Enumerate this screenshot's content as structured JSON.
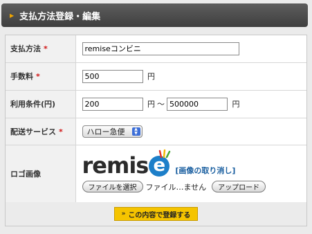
{
  "header": {
    "title": "支払方法登録・編集"
  },
  "form": {
    "method": {
      "label": "支払方法",
      "required_mark": "*",
      "value": "remiseコンビニ"
    },
    "fee": {
      "label": "手数料",
      "required_mark": "*",
      "value": "500",
      "unit": "円"
    },
    "conditions": {
      "label": "利用条件(円)",
      "min": "200",
      "max": "500000",
      "unit": "円",
      "separator": "〜"
    },
    "delivery": {
      "label": "配送サービス",
      "required_mark": "*",
      "selected": "ハロー急便"
    },
    "logo": {
      "label": "ロゴ画像",
      "logo_text": "remis",
      "logo_e": "e",
      "delete_link": "[画像の取り消し]",
      "choose_button": "ファイルを選択",
      "file_name": "ファイル…ません",
      "upload_button": "アップロード"
    }
  },
  "footer": {
    "submit_label": "この内容で登録する",
    "submit_chevron": "»"
  },
  "colors": {
    "accent": "#f5c400",
    "required": "#d01515",
    "link": "#1a5fa0",
    "logo_blue": "#1d7fc9"
  }
}
